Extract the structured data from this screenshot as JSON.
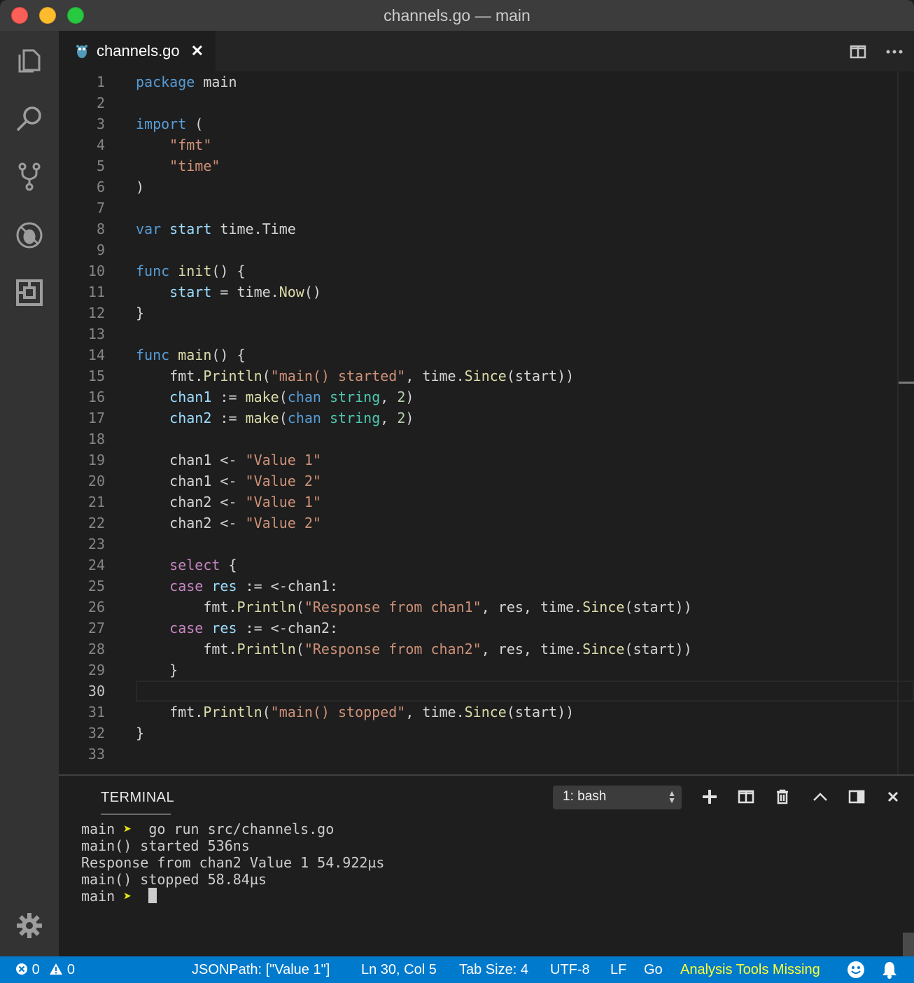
{
  "window": {
    "title": "channels.go — main"
  },
  "activity_bar": {
    "icons": [
      "files-icon",
      "search-icon",
      "source-control-icon",
      "debug-icon",
      "extensions-icon",
      "gear-icon"
    ]
  },
  "tab": {
    "label": "channels.go",
    "close": "✕"
  },
  "editor": {
    "line_numbers": [
      "1",
      "2",
      "3",
      "4",
      "5",
      "6",
      "7",
      "8",
      "9",
      "10",
      "11",
      "12",
      "13",
      "14",
      "15",
      "16",
      "17",
      "18",
      "19",
      "20",
      "21",
      "22",
      "23",
      "24",
      "25",
      "26",
      "27",
      "28",
      "29",
      "30",
      "31",
      "32",
      "33"
    ],
    "active_line": "30",
    "lines": {
      "l1": [
        "package",
        " main"
      ],
      "l3": [
        "import",
        " ("
      ],
      "l4": [
        "    ",
        "\"fmt\""
      ],
      "l5": [
        "    ",
        "\"time\""
      ],
      "l6": [
        ")"
      ],
      "l8": [
        "var",
        " ",
        "start",
        " time.Time"
      ],
      "l10": [
        "func",
        " ",
        "init",
        "() {"
      ],
      "l11": [
        "    ",
        "start",
        " = time.",
        "Now",
        "()"
      ],
      "l12": [
        "}"
      ],
      "l14": [
        "func",
        " ",
        "main",
        "() {"
      ],
      "l15": [
        "    fmt.",
        "Println",
        "(",
        "\"main() started\"",
        ", time.",
        "Since",
        "(start))"
      ],
      "l16": [
        "    ",
        "chan1",
        " := ",
        "make",
        "(",
        "chan",
        " ",
        "string",
        ", ",
        "2",
        ")"
      ],
      "l17": [
        "    ",
        "chan2",
        " := ",
        "make",
        "(",
        "chan",
        " ",
        "string",
        ", ",
        "2",
        ")"
      ],
      "l19": [
        "    chan1 <- ",
        "\"Value 1\""
      ],
      "l20": [
        "    chan1 <- ",
        "\"Value 2\""
      ],
      "l21": [
        "    chan2 <- ",
        "\"Value 1\""
      ],
      "l22": [
        "    chan2 <- ",
        "\"Value 2\""
      ],
      "l24": [
        "    ",
        "select",
        " {"
      ],
      "l25": [
        "    ",
        "case",
        " ",
        "res",
        " := <-chan1:"
      ],
      "l26": [
        "        fmt.",
        "Println",
        "(",
        "\"Response from chan1\"",
        ", res, time.",
        "Since",
        "(start))"
      ],
      "l27": [
        "    ",
        "case",
        " ",
        "res",
        " := <-chan2:"
      ],
      "l28": [
        "        fmt.",
        "Println",
        "(",
        "\"Response from chan2\"",
        ", res, time.",
        "Since",
        "(start))"
      ],
      "l29": [
        "    }"
      ],
      "l31": [
        "    fmt.",
        "Println",
        "(",
        "\"main() stopped\"",
        ", time.",
        "Since",
        "(start))"
      ],
      "l32": [
        "}"
      ]
    }
  },
  "panel": {
    "title": "TERMINAL",
    "terminal_select": "1: bash",
    "output": {
      "p1_prompt": "main",
      "p1_arrow": "➤",
      "p1_cmd": "  go run src/channels.go",
      "o1": "main() started 536ns",
      "o2": "Response from chan2 Value 1 54.922µs",
      "o3": "main() stopped 58.84µs",
      "p2_prompt": "main",
      "p2_arrow": "➤"
    }
  },
  "status_bar": {
    "errors": "0",
    "warnings": "0",
    "jsonpath": "JSONPath: [\"Value 1\"]",
    "position": "Ln 30, Col 5",
    "tab_size": "Tab Size: 4",
    "encoding": "UTF-8",
    "eol": "LF",
    "language": "Go",
    "analysis": "Analysis Tools Missing"
  },
  "colors": {
    "keyword": "#569cd6",
    "string": "#ce9178",
    "function": "#dcdcaa",
    "variable": "#9cdcfe",
    "type": "#4ec9b0",
    "control": "#c586c0",
    "number": "#b5cea8",
    "status_bar": "#007acc"
  }
}
